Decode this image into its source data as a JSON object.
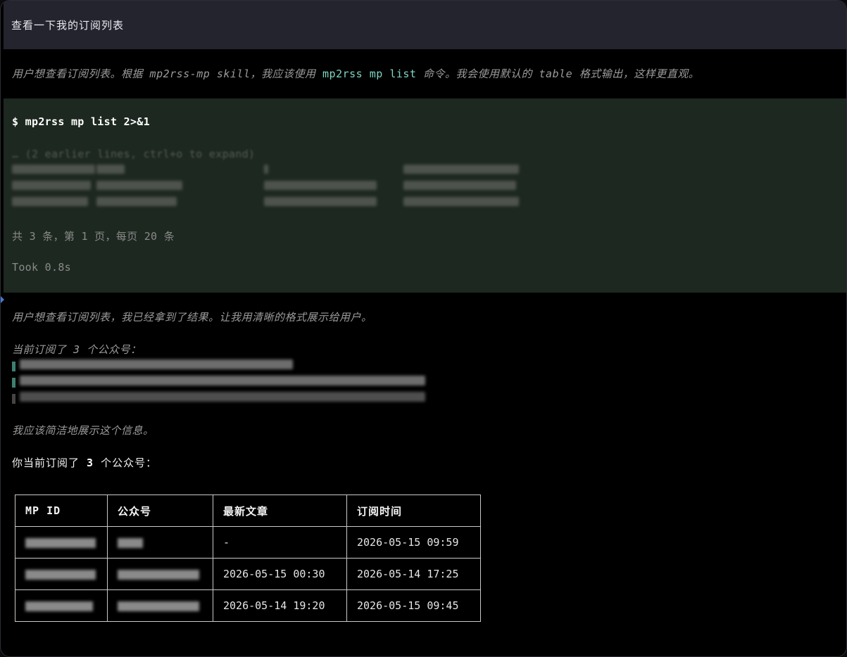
{
  "header": {
    "title": "查看一下我的订阅列表"
  },
  "thought1": {
    "prefix": "用户想查看订阅列表。根据 mp2rss-mp skill，我应该使用 ",
    "command": "mp2rss mp list",
    "suffix": " 命令。我会使用默认的 table 格式输出，这样更直观。"
  },
  "terminal": {
    "command": "$ mp2rss mp list 2>&1",
    "collapsed_hint": "… (2 earlier lines, ctrl+o to expand)",
    "pagination": "共 3 条，第 1 页，每页 20 条",
    "timing": "Took 0.8s"
  },
  "thought2": {
    "line1": "用户想查看订阅列表，我已经拿到了结果。让我用清晰的格式展示给用户。",
    "line2": "当前订阅了 3 个公众号：",
    "line3": "我应该简洁地展示这个信息。"
  },
  "summary": {
    "prefix": "你当前订阅了 ",
    "count": "3",
    "suffix": " 个公众号："
  },
  "table": {
    "headers": [
      "MP ID",
      "公众号",
      "最新文章",
      "订阅时间"
    ],
    "rows": [
      {
        "latest": "-",
        "subscribed": "2026-05-15 09:59"
      },
      {
        "latest": "2026-05-15 00:30",
        "subscribed": "2026-05-14 17:25"
      },
      {
        "latest": "2026-05-14 19:20",
        "subscribed": "2026-05-15 09:45"
      }
    ]
  },
  "colors": {
    "accent": "#7fd6c5",
    "terminal_bg": "#1d2820",
    "header_bg": "#24242e"
  }
}
